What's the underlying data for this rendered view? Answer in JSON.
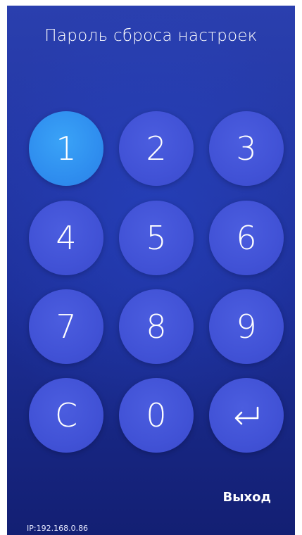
{
  "header": {
    "title": "Пароль сброса настроек"
  },
  "keypad": {
    "keys": [
      {
        "label": "1",
        "active": true
      },
      {
        "label": "2"
      },
      {
        "label": "3"
      },
      {
        "label": "4"
      },
      {
        "label": "5"
      },
      {
        "label": "6"
      },
      {
        "label": "7"
      },
      {
        "label": "8"
      },
      {
        "label": "9"
      },
      {
        "label": "C"
      },
      {
        "label": "0"
      },
      {
        "icon": "enter-icon"
      }
    ]
  },
  "footer": {
    "exit_label": "Выход",
    "ip_text": "IP:192.168.0.86"
  },
  "colors": {
    "background_top": "#2a3fae",
    "background_bottom": "#131f73",
    "key": "#4152d6",
    "key_active": "#2f8eef",
    "text": "#ffffff"
  }
}
